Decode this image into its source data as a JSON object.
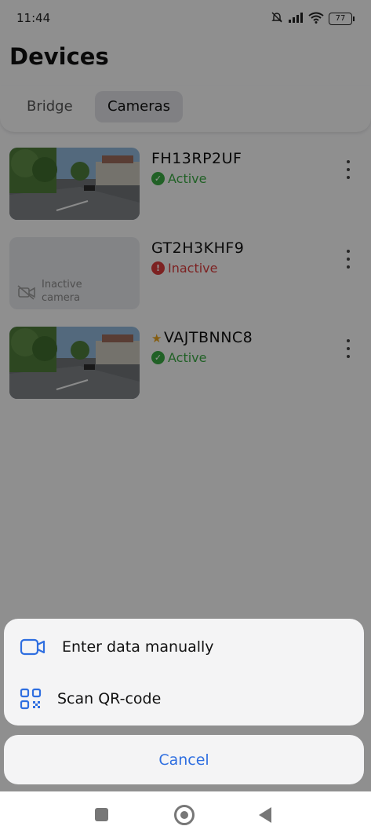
{
  "status_bar": {
    "time": "11:44",
    "battery": "77"
  },
  "header": {
    "title": "Devices"
  },
  "tabs": [
    {
      "label": "Bridge"
    },
    {
      "label": "Cameras"
    }
  ],
  "devices": [
    {
      "name": "FH13RP2UF",
      "status": "Active",
      "state": "active",
      "favorite": false
    },
    {
      "name": "GT2H3KHF9",
      "status": "Inactive",
      "state": "inactive",
      "favorite": false,
      "thumb_label": "Inactive camera"
    },
    {
      "name": "VAJTBNNC8",
      "status": "Active",
      "state": "active",
      "favorite": true
    }
  ],
  "sheet": {
    "items": [
      {
        "label": "Enter data manually",
        "icon": "video-camera-icon"
      },
      {
        "label": "Scan QR-code",
        "icon": "qr-code-icon"
      }
    ],
    "cancel_label": "Cancel"
  },
  "colors": {
    "accent": "#2e6ee0",
    "active": "#3aa843",
    "inactive": "#d73b3b",
    "favorite": "#e6a01c"
  }
}
